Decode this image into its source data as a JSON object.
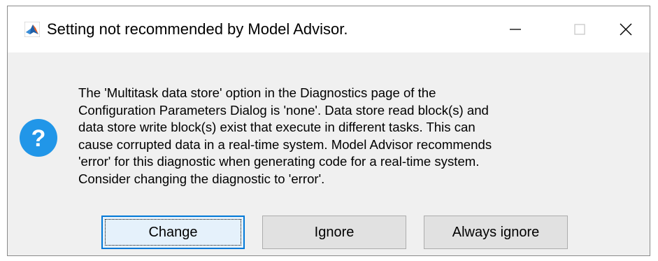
{
  "window": {
    "title": "Setting not recommended by Model Advisor.",
    "controls": {
      "minimize_icon": "minimize-icon",
      "maximize_icon": "maximize-icon",
      "close_icon": "close-icon"
    }
  },
  "dialog": {
    "icon": "question-icon",
    "message_lines": [
      "The 'Multitask data store' option in the Diagnostics page of the",
      "Configuration Parameters Dialog is 'none'. Data store read block(s) and",
      "data store write block(s) exist that execute in different tasks. This can",
      "cause corrupted data in a real-time system. Model Advisor recommends",
      "'error' for this diagnostic when generating code for a real-time system.",
      "Consider changing the diagnostic to 'error'."
    ],
    "buttons": {
      "change": "Change",
      "ignore": "Ignore",
      "always_ignore": "Always ignore"
    }
  },
  "colors": {
    "question_icon": "#2196e8",
    "focus_border": "#0078d7",
    "button_bg": "#e1e1e1",
    "dialog_bg": "#f0f0f0"
  }
}
